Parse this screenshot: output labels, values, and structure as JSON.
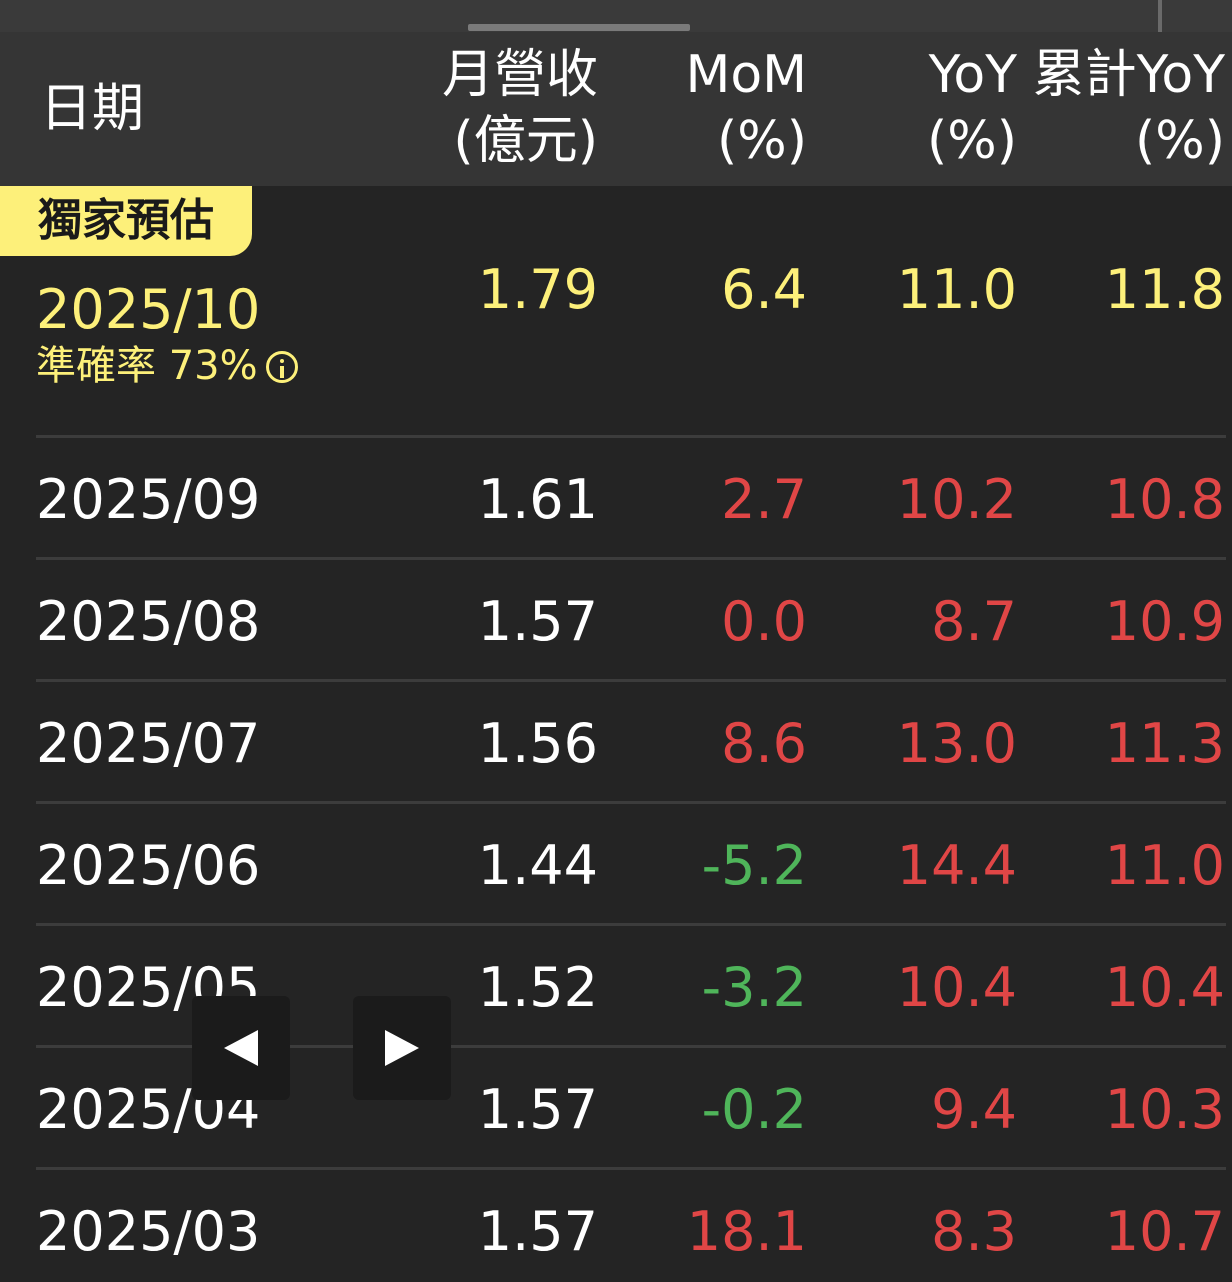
{
  "header": {
    "date_label": "日期",
    "revenue_line1": "月營收",
    "revenue_line2": "(億元)",
    "mom_line1": "MoM",
    "mom_line2": "(%)",
    "yoy_line1": "YoY",
    "yoy_line2": "(%)",
    "cum_line1": "累計YoY",
    "cum_line2": "(%)"
  },
  "estimate": {
    "tag": "獨家預估",
    "date": "2025/10",
    "accuracy": "準確率 73%",
    "revenue": "1.79",
    "mom": "6.4",
    "yoy": "11.0",
    "cum_yoy": "11.8"
  },
  "rows": [
    {
      "date": "2025/09",
      "revenue": "1.61",
      "mom": "2.7",
      "yoy": "10.2",
      "cum_yoy": "10.8"
    },
    {
      "date": "2025/08",
      "revenue": "1.57",
      "mom": "0.0",
      "yoy": "8.7",
      "cum_yoy": "10.9"
    },
    {
      "date": "2025/07",
      "revenue": "1.56",
      "mom": "8.6",
      "yoy": "13.0",
      "cum_yoy": "11.3"
    },
    {
      "date": "2025/06",
      "revenue": "1.44",
      "mom": "-5.2",
      "yoy": "14.4",
      "cum_yoy": "11.0"
    },
    {
      "date": "2025/05",
      "revenue": "1.52",
      "mom": "-3.2",
      "yoy": "10.4",
      "cum_yoy": "10.4"
    },
    {
      "date": "2025/04",
      "revenue": "1.57",
      "mom": "-0.2",
      "yoy": "9.4",
      "cum_yoy": "10.3"
    },
    {
      "date": "2025/03",
      "revenue": "1.57",
      "mom": "18.1",
      "yoy": "8.3",
      "cum_yoy": "10.7"
    }
  ],
  "colors": {
    "estimate": "#fdf07a",
    "positive": "#e04646",
    "negative": "#4fb55a"
  },
  "icons": {
    "info": "info-circle-icon",
    "prev": "triangle-left-icon",
    "next": "triangle-right-icon"
  }
}
